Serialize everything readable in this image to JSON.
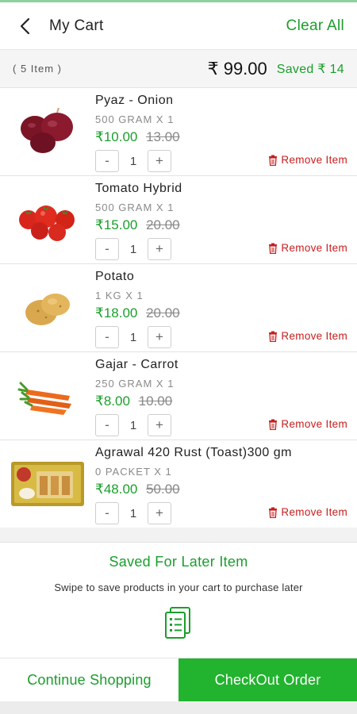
{
  "header": {
    "title": "My Cart",
    "clear_all": "Clear All"
  },
  "summary": {
    "item_count": "( 5 Item )",
    "total": "₹ 99.00",
    "saved": "Saved ₹ 14"
  },
  "items": [
    {
      "name": "Pyaz - Onion",
      "qty": "500 GRAM X 1",
      "price": "₹10.00",
      "mrp": "13.00",
      "count": "1",
      "remove": "Remove Item",
      "image": "onion-image"
    },
    {
      "name": "Tomato Hybrid",
      "qty": "500 GRAM X 1",
      "price": "₹15.00",
      "mrp": "20.00",
      "count": "1",
      "remove": "Remove Item",
      "image": "tomato-image"
    },
    {
      "name": "Potato",
      "qty": "1 KG X 1",
      "price": "₹18.00",
      "mrp": "20.00",
      "count": "1",
      "remove": "Remove Item",
      "image": "potato-image"
    },
    {
      "name": "Gajar - Carrot",
      "qty": "250 GRAM X 1",
      "price": "₹8.00",
      "mrp": "10.00",
      "count": "1",
      "remove": "Remove Item",
      "image": "carrot-image"
    },
    {
      "name": "Agrawal 420 Rust (Toast)300 gm",
      "qty": "0 PACKET X 1",
      "price": "₹48.00",
      "mrp": "50.00",
      "count": "1",
      "remove": "Remove Item",
      "image": "rusk-image"
    }
  ],
  "stepper": {
    "minus": "-",
    "plus": "+"
  },
  "saved_later": {
    "title": "Saved For Later Item",
    "subtitle": "Swipe to save products in your cart to purchase later"
  },
  "footer": {
    "continue": "Continue Shopping",
    "checkout": "CheckOut Order"
  },
  "colors": {
    "accent": "#1a9e2c",
    "checkout_bg": "#22b32f",
    "remove": "#c81e1e"
  },
  "icons": {
    "back": "back-arrow-icon",
    "remove": "trash-icon",
    "saved_later": "document-list-icon"
  }
}
